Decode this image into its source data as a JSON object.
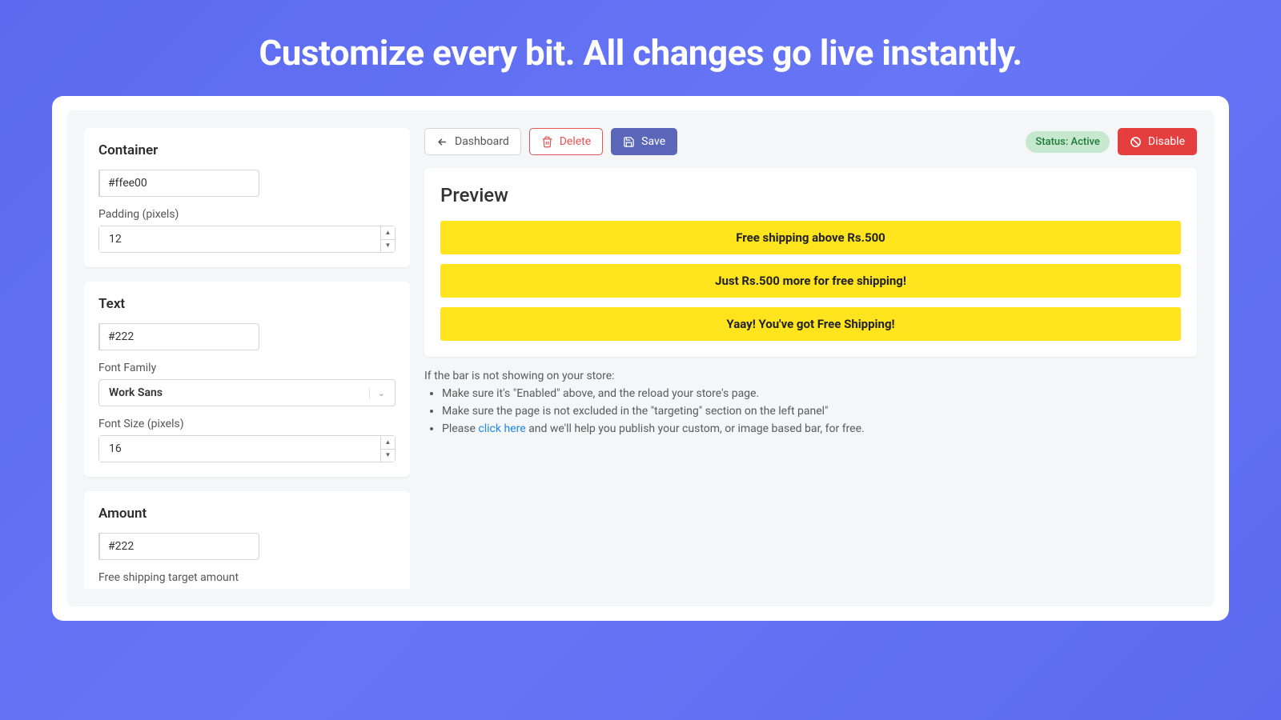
{
  "hero": {
    "title": "Customize every bit. All changes go live instantly."
  },
  "sidebar": {
    "container": {
      "title": "Container",
      "color": "#ffee00",
      "padding_label": "Padding (pixels)",
      "padding": "12"
    },
    "text": {
      "title": "Text",
      "color": "#222",
      "swatch": "#222",
      "font_family_label": "Font Family",
      "font_family": "Work Sans",
      "font_size_label": "Font Size (pixels)",
      "font_size": "16"
    },
    "amount": {
      "title": "Amount",
      "color": "#222",
      "swatch": "#222",
      "target_label": "Free shipping target amount"
    }
  },
  "toolbar": {
    "dashboard": "Dashboard",
    "delete": "Delete",
    "save": "Save",
    "status": "Status: Active",
    "disable": "Disable"
  },
  "preview": {
    "title": "Preview",
    "bars": [
      "Free shipping above Rs.500",
      "Just Rs.500 more for free shipping!",
      "Yaay! You've got Free Shipping!"
    ]
  },
  "help": {
    "intro": "If the bar is not showing on your store:",
    "items": [
      "Make sure it's \"Enabled\" above, and the reload your store's page.",
      "Make sure the page is not excluded in the \"targeting\" section on the left panel\""
    ],
    "item3_prefix": "Please ",
    "item3_link": "click here",
    "item3_suffix": " and we'll help you publish your custom, or image based bar, for free."
  }
}
